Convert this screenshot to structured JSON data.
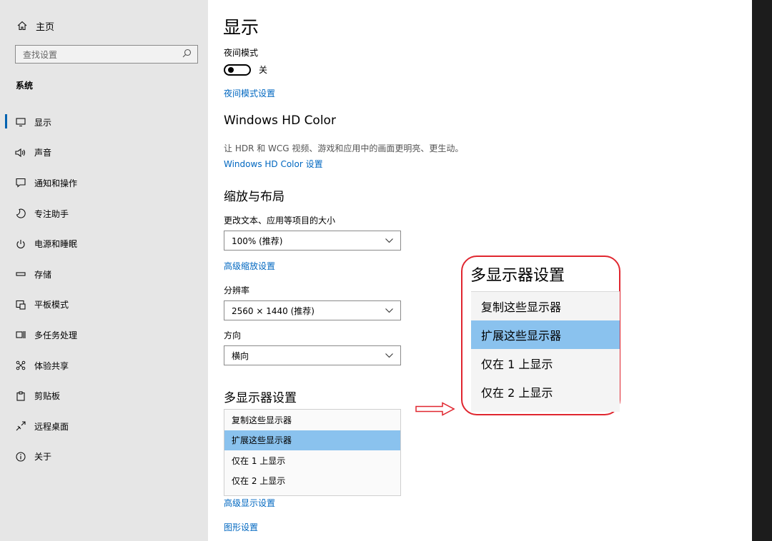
{
  "sidebar": {
    "home_label": "主页",
    "search_placeholder": "查找设置",
    "section_title": "系统",
    "items": [
      {
        "label": "显示",
        "icon": "monitor-icon"
      },
      {
        "label": "声音",
        "icon": "speaker-icon"
      },
      {
        "label": "通知和操作",
        "icon": "notification-icon"
      },
      {
        "label": "专注助手",
        "icon": "moon-icon"
      },
      {
        "label": "电源和睡眠",
        "icon": "power-icon"
      },
      {
        "label": "存储",
        "icon": "storage-icon"
      },
      {
        "label": "平板模式",
        "icon": "tablet-icon"
      },
      {
        "label": "多任务处理",
        "icon": "multitask-icon"
      },
      {
        "label": "体验共享",
        "icon": "share-icon"
      },
      {
        "label": "剪贴板",
        "icon": "clipboard-icon"
      },
      {
        "label": "远程桌面",
        "icon": "remote-icon"
      },
      {
        "label": "关于",
        "icon": "info-icon"
      }
    ],
    "active_index": 0
  },
  "main": {
    "title": "显示",
    "night": {
      "label": "夜间模式",
      "state": "关",
      "link": "夜间模式设置"
    },
    "hd": {
      "title": "Windows HD Color",
      "desc": "让 HDR 和 WCG 视频、游戏和应用中的画面更明亮、更生动。",
      "link": "Windows HD Color 设置"
    },
    "scale": {
      "title": "缩放与布局",
      "size_label": "更改文本、应用等项目的大小",
      "size_value": "100% (推荐)",
      "adv_link": "高级缩放设置",
      "res_label": "分辨率",
      "res_value": "2560 × 1440 (推荐)",
      "orient_label": "方向",
      "orient_value": "横向"
    },
    "multi": {
      "title": "多显示器设置",
      "options": [
        "复制这些显示器",
        "扩展这些显示器",
        "仅在 1 上显示",
        "仅在 2 上显示"
      ],
      "selected": 1,
      "adv_link": "高级显示设置",
      "graphics_link": "图形设置"
    }
  },
  "callout": {
    "title": "多显示器设置",
    "options": [
      "复制这些显示器",
      "扩展这些显示器",
      "仅在 1 上显示",
      "仅在 2 上显示"
    ],
    "selected": 1
  },
  "colors": {
    "accent": "#0067c0",
    "selection": "#8ac2ee",
    "callout_border": "#e0262f"
  }
}
